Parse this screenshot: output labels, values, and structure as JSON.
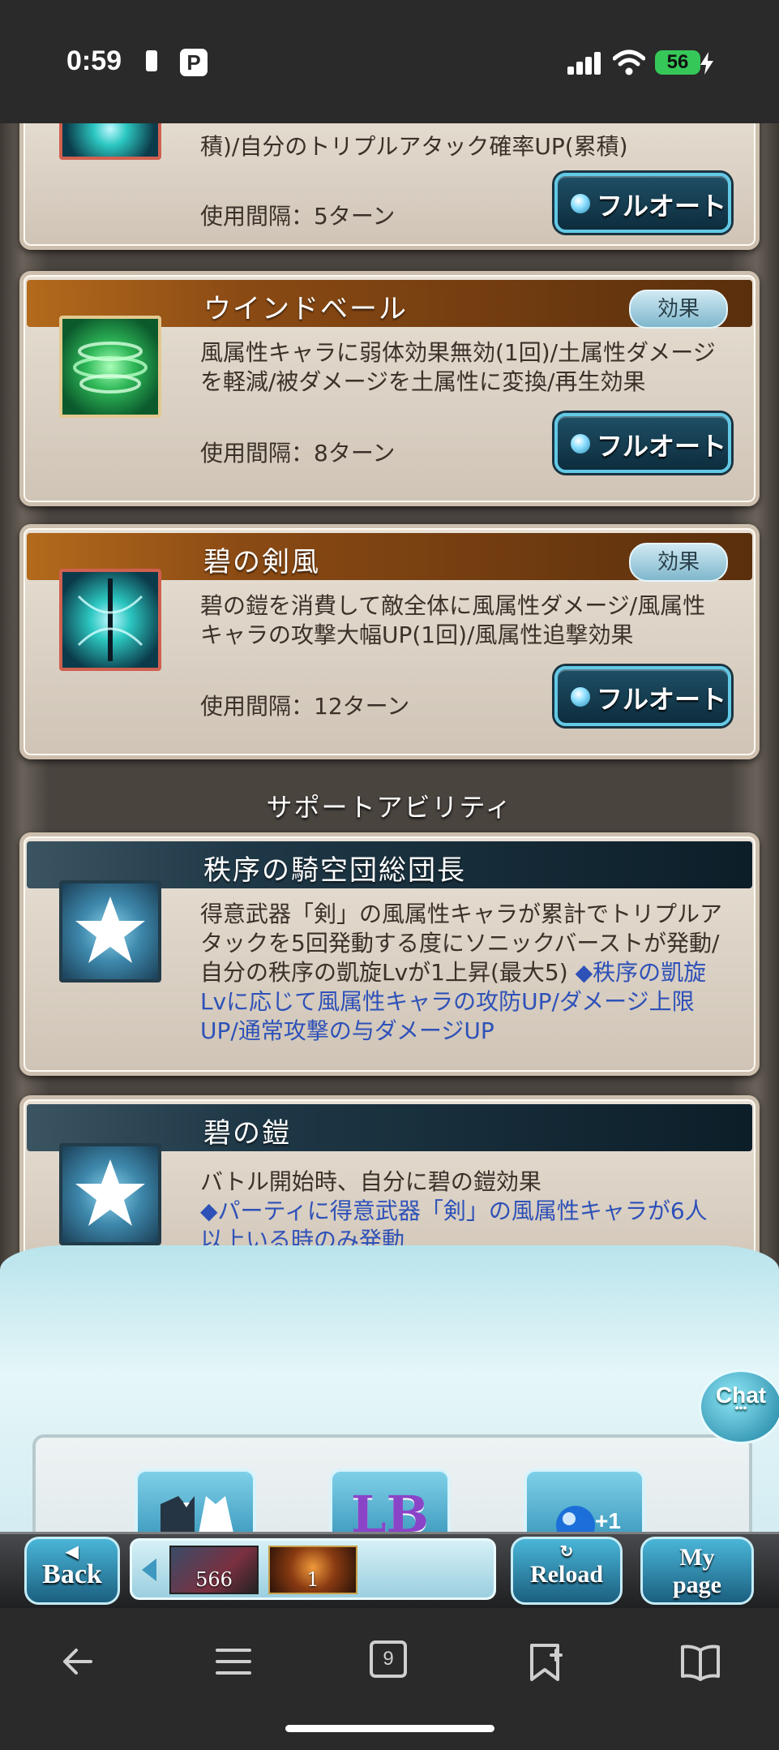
{
  "status_bar": {
    "time": "0:59",
    "pay_badge": "P",
    "battery": "56"
  },
  "abilities": [
    {
      "partial_desc": "積)/自分のトリプルアタック確率UP(累積)",
      "interval": "使用間隔：5ターン",
      "auto_button": "フルオート"
    },
    {
      "name": "ウインドベール",
      "effect_badge": "効果",
      "desc": "風属性キャラに弱体効果無効(1回)/土属性ダメージを軽減/被ダメージを土属性に変換/再生効果",
      "interval": "使用間隔：8ターン",
      "auto_button": "フルオート"
    },
    {
      "name": "碧の剣風",
      "effect_badge": "効果",
      "desc": "碧の鎧を消費して敵全体に風属性ダメージ/風属性キャラの攻撃大幅UP(1回)/風属性追撃効果",
      "interval": "使用間隔：12ターン",
      "auto_button": "フルオート"
    }
  ],
  "support_header": "サポートアビリティ",
  "supports": [
    {
      "name": "秩序の騎空団総団長",
      "desc": "得意武器「剣」の風属性キャラが累計でトリプルアタックを5回発動する度にソニックバーストが発動/自分の秩序の凱旋Lvが1上昇(最大5)",
      "note": "◆秩序の凱旋Lvに応じて風属性キャラの攻防UP/ダメージ上限UP/通常攻撃の与ダメージUP"
    },
    {
      "name": "碧の鎧",
      "desc": "バトル開始時、自分に碧の鎧効果",
      "note": "◆パーティに得意武器「剣」の風属性キャラが6人以上いる時のみ発動"
    }
  ],
  "chat_button": "Chat",
  "chat_dots": "•••",
  "menu": {
    "lb": "LB"
  },
  "bottom_bar": {
    "back_small": "◀",
    "back": "Back",
    "reload_small": "↻",
    "reload": "Reload",
    "mypage_small": "My",
    "mypage": "page",
    "item1_count": "566",
    "item2_count": "1"
  },
  "browser": {
    "tab_count": "9"
  }
}
